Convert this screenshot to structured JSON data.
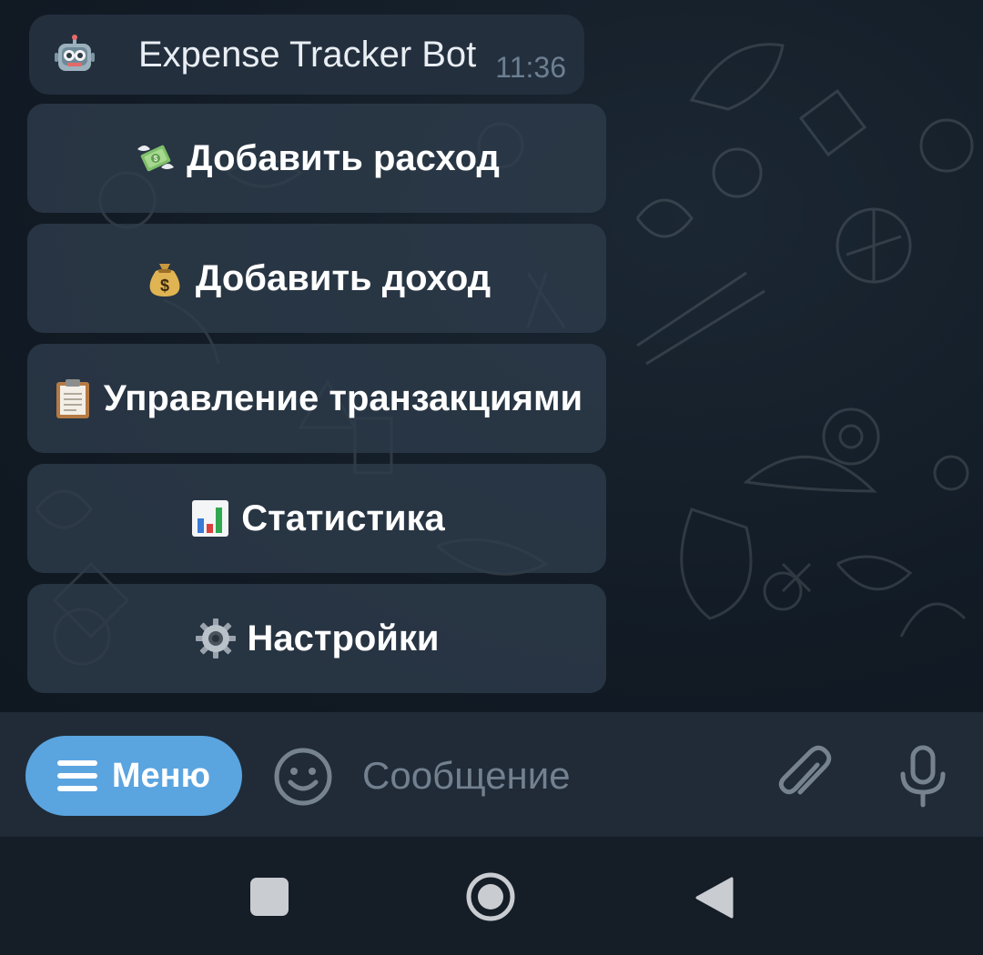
{
  "message": {
    "sender_emoji": "robot-face",
    "text": "Expense Tracker Bot",
    "time": "11:36"
  },
  "keyboard": {
    "buttons": [
      {
        "icon": "money-with-wings-icon",
        "label": "Добавить расход"
      },
      {
        "icon": "money-bag-icon",
        "label": "Добавить доход"
      },
      {
        "icon": "clipboard-icon",
        "label": "Управление транзакциями"
      },
      {
        "icon": "bar-chart-icon",
        "label": "Статистика"
      },
      {
        "icon": "gear-icon",
        "label": "Настройки"
      }
    ]
  },
  "input_bar": {
    "menu_label": "Меню",
    "placeholder": "Сообщение"
  },
  "colors": {
    "accent": "#5aa4e0",
    "bubble": "#232f3d",
    "keyboard_button": "#2e3c4b",
    "input_bar": "#202b37",
    "nav_bar": "#151d27"
  }
}
